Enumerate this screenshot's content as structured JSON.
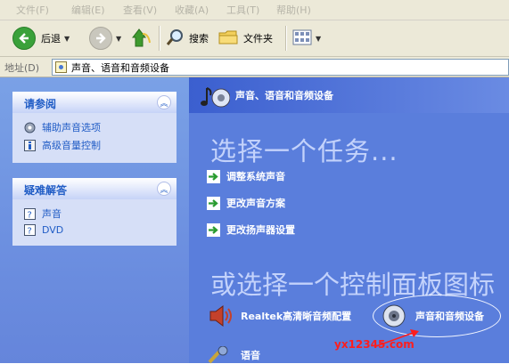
{
  "menu": [
    "文件(F)",
    "编辑(E)",
    "查看(V)",
    "收藏(A)",
    "工具(T)",
    "帮助(H)"
  ],
  "toolbar": {
    "back_label": "后退",
    "search_label": "搜索",
    "folders_label": "文件夹"
  },
  "address": {
    "label": "地址(D)",
    "value": "声音、语音和音频设备"
  },
  "see_also": {
    "title": "请参阅",
    "items": [
      {
        "label": "辅助声音选项",
        "icon": "accessibility-icon"
      },
      {
        "label": "高级音量控制",
        "icon": "advanced-info-icon"
      }
    ]
  },
  "troubleshoot": {
    "title": "疑难解答",
    "items": [
      {
        "label": "声音",
        "icon": "help-icon"
      },
      {
        "label": "DVD",
        "icon": "help-icon"
      }
    ]
  },
  "content": {
    "title": "声音、语音和音频设备",
    "task_heading": "选择一个任务...",
    "tasks": [
      "调整系统声音",
      "更改声音方案",
      "更改扬声器设置"
    ],
    "or_heading": "或选择一个控制面板图标",
    "items": [
      {
        "label": "Realtek高清晰音频配置",
        "icon": "speaker-icon"
      },
      {
        "label": "声音和音频设备",
        "icon": "audio-device-icon"
      },
      {
        "label": "语音",
        "icon": "speech-icon"
      }
    ]
  },
  "watermark": "yx12345.com",
  "colors": {
    "task_pane_bg": "#6c8fe0",
    "content_bg": "#5a7edc",
    "panel_bg": "#d6dff7",
    "link_blue": "#215dc6",
    "task_arrow": "#2a9c30",
    "watermark_red": "#ff1d1d"
  }
}
